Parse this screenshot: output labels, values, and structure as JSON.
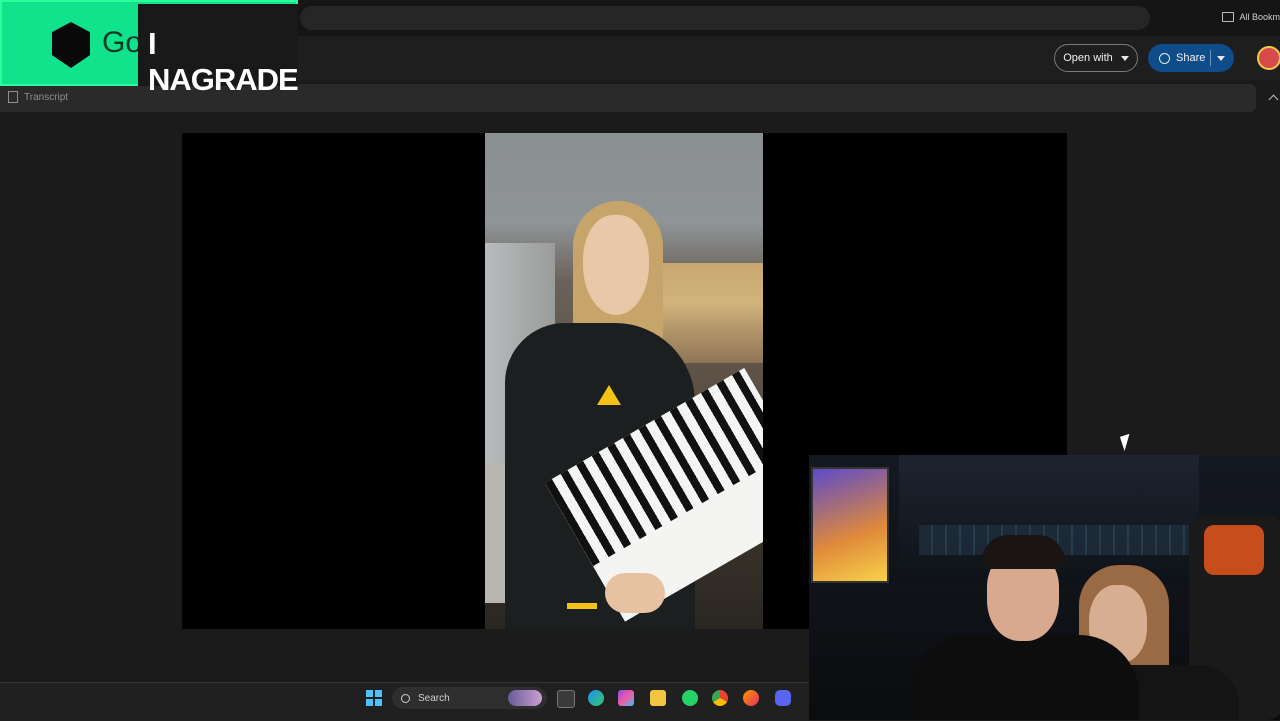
{
  "browser": {
    "bookmarks_label": "All Bookm"
  },
  "toolbar": {
    "open_with_label": "Open with",
    "share_label": "Share"
  },
  "transcript": {
    "label": "Transcript"
  },
  "overlay": {
    "logo_text_partial": "Go",
    "logo_text": "I NAGRADE",
    "brand_color": "#10e38b"
  },
  "taskbar": {
    "search_placeholder": "Search"
  },
  "icons": [
    "folder-icon",
    "caret-down-icon",
    "globe-icon",
    "transcript-icon",
    "collapse-icon",
    "windows-start-icon",
    "search-icon",
    "edge-icon",
    "copilot-icon",
    "file-explorer-icon",
    "whatsapp-icon",
    "chrome-icon",
    "firefox-icon",
    "discord-icon",
    "mouse-cursor-icon"
  ],
  "colors": {
    "accent_share": "#0e4c8a",
    "windows_blue": "#4cc2ff"
  }
}
